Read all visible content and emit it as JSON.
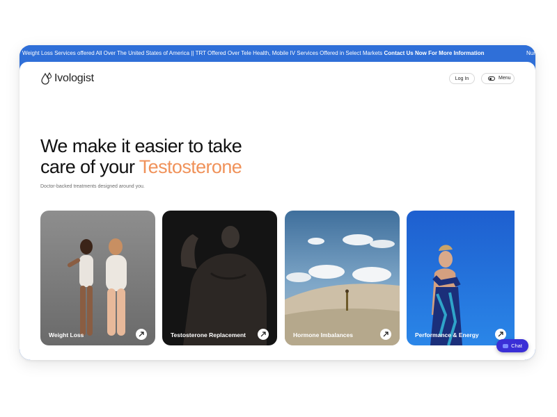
{
  "ticker": {
    "text": "Weight Loss Services offered All Over The United States of America || TRT Offered Over Tele Health, Mobile IV Services Offered in Select Markets",
    "cta": "Contact Us Now For More Information",
    "next": "Nur"
  },
  "header": {
    "logo_text": "Ivologist",
    "login_label": "Log In",
    "menu_label": "Menu"
  },
  "hero": {
    "headline_line1": "We make it easier to take",
    "headline_line2_prefix": "care of your ",
    "headline_accent": "Testosterone",
    "subtitle": "Doctor-backed treatments designed around you."
  },
  "cards": [
    {
      "label": "Weight Loss"
    },
    {
      "label": "Testosterone Replacement"
    },
    {
      "label": "Hormone Imbalances"
    },
    {
      "label": "Performance & Energy"
    }
  ],
  "chat": {
    "label": "Chat"
  },
  "colors": {
    "ticker_bg": "#2f6fd8",
    "accent": "#f0925a",
    "chat_bg": "#3a2fd6"
  }
}
